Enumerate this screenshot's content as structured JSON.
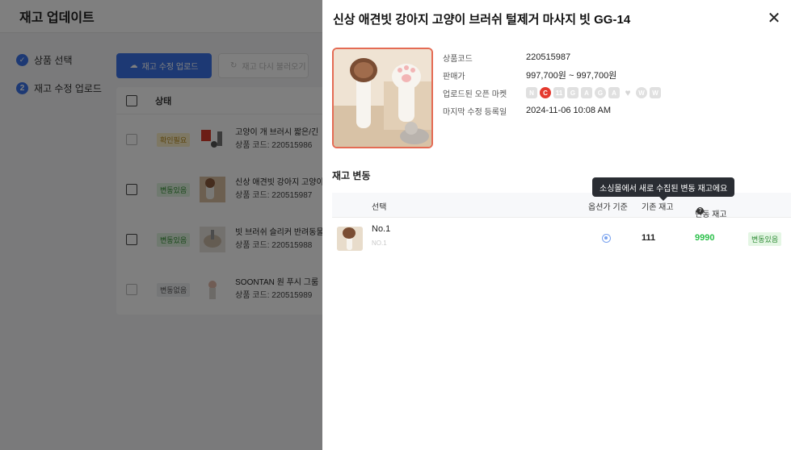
{
  "background": {
    "title": "재고 업데이트",
    "steps": [
      {
        "label": "상품 선택",
        "icon": "check-circle-icon"
      },
      {
        "label": "재고 수정 업로드",
        "number": "2"
      }
    ],
    "toolbar": {
      "upload_label": "재고 수정 업로드",
      "reload_label": "재고 다시 불러오기"
    },
    "table": {
      "status_header": "상태",
      "rows": [
        {
          "status": "확인필요",
          "name": "고양이 개 브러시 짧은/긴",
          "code": "상품 코드: 220515986"
        },
        {
          "status": "변동있음",
          "name": "신상 애견빗 강아지 고양이",
          "code": "상품 코드: 220515987"
        },
        {
          "status": "변동있음",
          "name": "빗 브러쉬 슬리커 반려동물",
          "code": "상품 코드: 220515988"
        },
        {
          "status": "변동없음",
          "name": "SOONTAN 원 푸시 그룸",
          "code": "상품 코드: 220515989"
        }
      ]
    }
  },
  "drawer": {
    "title": "신상 애견빗 강아지 고양이 브러쉬 털제거 마사지 빗 GG-14",
    "info": {
      "code_label": "상품코드",
      "code_value": "220515987",
      "price_label": "판매가",
      "price_value": "997,700원 ~ 997,700원",
      "markets_label": "업로드된 오픈 마켓",
      "markets": [
        "N",
        "C",
        "11",
        "G",
        "A",
        "G",
        "A",
        "♥",
        "W",
        "W"
      ],
      "modified_label": "마지막 수정 등록일",
      "modified_value": "2024-11-06 10:08 AM"
    },
    "section_title": "재고 변동",
    "tooltip": "소싱몰에서 새로 수집된 변동 재고에요",
    "columns": {
      "select": "선택",
      "option_basis": "옵션가 기준",
      "base_stock": "기존 재고",
      "var_stock": "변동 재고"
    },
    "row": {
      "option_name": "No.1",
      "option_sub": "NO.1",
      "base_stock": "111",
      "var_stock": "9990",
      "status": "변동있음"
    }
  }
}
